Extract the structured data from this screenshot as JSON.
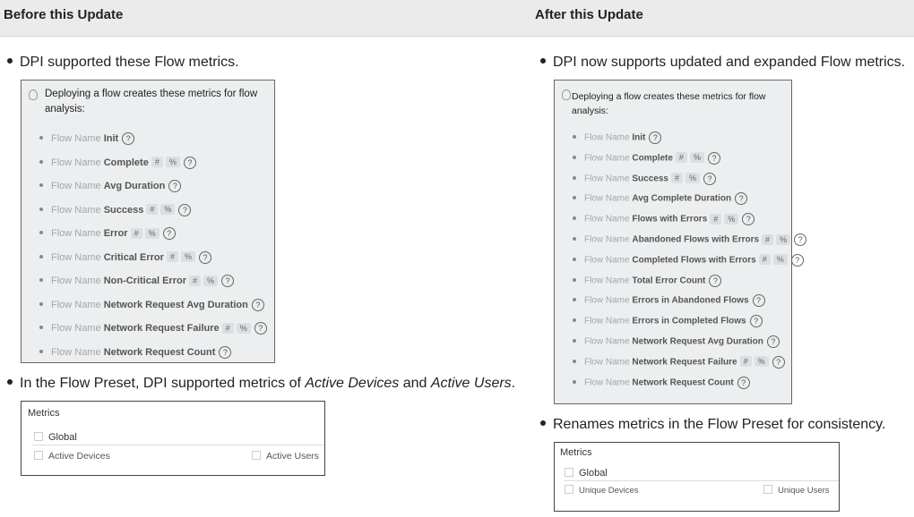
{
  "header": {
    "before_title": "Before this Update",
    "after_title": "After this Update"
  },
  "before": {
    "bullet1": "DPI supported these Flow metrics.",
    "box": {
      "intro": "Deploying a flow creates these metrics for flow analysis:",
      "prefix": "Flow Name",
      "items": [
        {
          "name": "Init",
          "tags": [],
          "help": "?"
        },
        {
          "name": "Complete",
          "tags": [
            "#",
            "%"
          ],
          "help": "?"
        },
        {
          "name": "Avg Duration",
          "tags": [],
          "help": "?"
        },
        {
          "name": "Success",
          "tags": [
            "#",
            "%"
          ],
          "help": "?"
        },
        {
          "name": "Error",
          "tags": [
            "#",
            "%"
          ],
          "help": "?"
        },
        {
          "name": "Critical Error",
          "tags": [
            "#",
            "%"
          ],
          "help": "?"
        },
        {
          "name": "Non-Critical Error",
          "tags": [
            "#",
            "%"
          ],
          "help": "?"
        },
        {
          "name": "Network Request Avg Duration",
          "tags": [],
          "help": "?"
        },
        {
          "name": "Network Request Failure",
          "tags": [
            "#",
            "%"
          ],
          "help": "?"
        },
        {
          "name": "Network Request Count",
          "tags": [],
          "help": "?"
        }
      ]
    },
    "bullet2": {
      "pre": "In the Flow Preset, DPI supported metrics of ",
      "em1": "Active Devices",
      "mid": " and ",
      "em2": "Active Users",
      "post": "."
    },
    "preset": {
      "title": "Metrics",
      "global": "Global",
      "left": "Active Devices",
      "right": "Active Users"
    }
  },
  "after": {
    "bullet1": "DPI now supports updated and expanded Flow metrics.",
    "box": {
      "intro": "Deploying a flow creates these metrics for flow analysis:",
      "prefix": "Flow Name",
      "items": [
        {
          "name": "Init",
          "tags": [],
          "help": "?"
        },
        {
          "name": "Complete",
          "tags": [
            "#",
            "%"
          ],
          "help": "?"
        },
        {
          "name": "Success",
          "tags": [
            "#",
            "%"
          ],
          "help": "?"
        },
        {
          "name": "Avg Complete Duration",
          "tags": [],
          "help": "?"
        },
        {
          "name": "Flows with Errors",
          "tags": [
            "#",
            "%"
          ],
          "help": "?"
        },
        {
          "name": "Abandoned Flows with Errors",
          "tags": [
            "#",
            "%"
          ],
          "help": "?"
        },
        {
          "name": "Completed Flows with Errors",
          "tags": [
            "#",
            "%"
          ],
          "help": "?"
        },
        {
          "name": "Total Error Count",
          "tags": [],
          "help": "?"
        },
        {
          "name": "Errors in Abandoned Flows",
          "tags": [],
          "help": "?"
        },
        {
          "name": "Errors in Completed Flows",
          "tags": [],
          "help": "?"
        },
        {
          "name": "Network Request Avg Duration",
          "tags": [],
          "help": "?"
        },
        {
          "name": "Network Request Failure",
          "tags": [
            "#",
            "%"
          ],
          "help": "?"
        },
        {
          "name": "Network Request Count",
          "tags": [],
          "help": "?"
        }
      ]
    },
    "bullet2": "Renames metrics in the Flow Preset for consistency.",
    "preset": {
      "title": "Metrics",
      "global": "Global",
      "left": "Unique Devices",
      "right": "Unique Users"
    }
  }
}
